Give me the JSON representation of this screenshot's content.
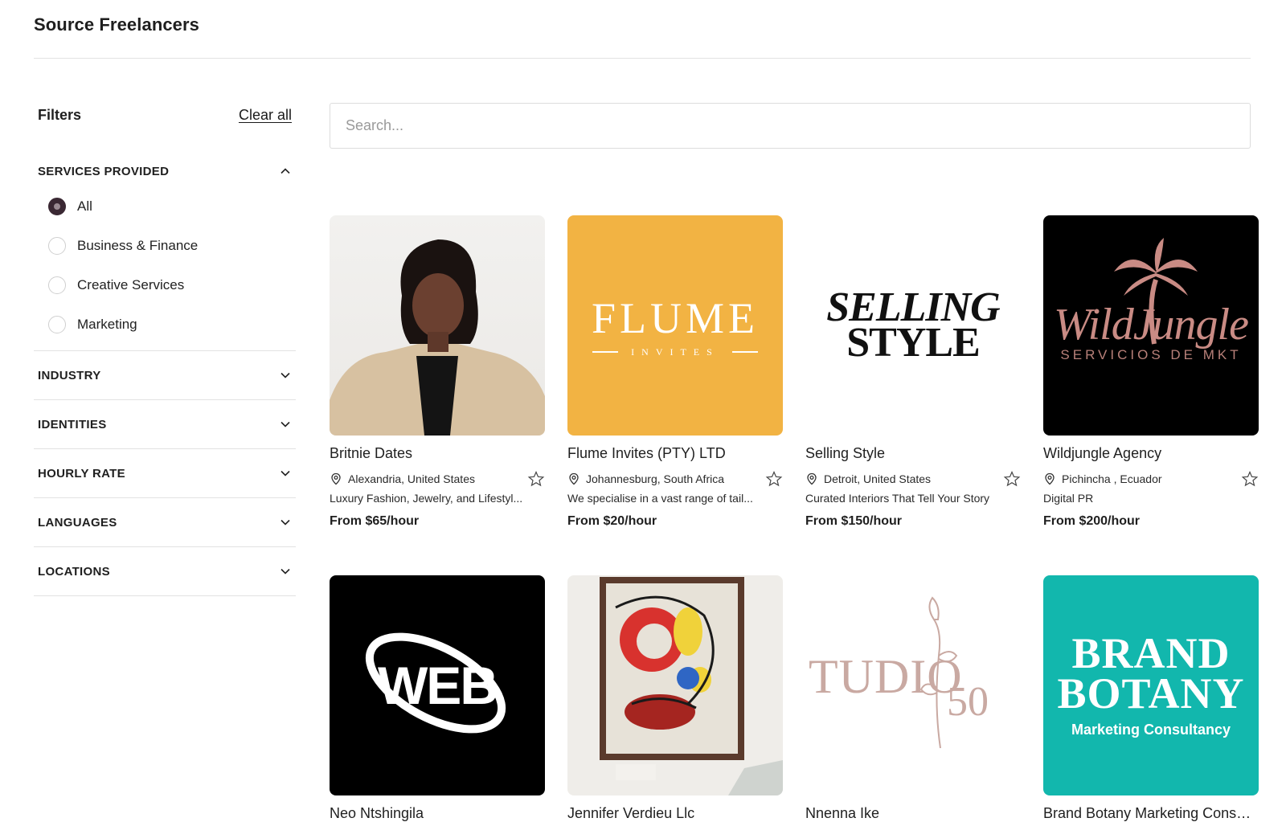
{
  "page": {
    "title": "Source Freelancers"
  },
  "filters": {
    "title": "Filters",
    "clear_all": "Clear all",
    "services": {
      "title": "SERVICES PROVIDED",
      "options": [
        {
          "label": "All",
          "checked": true
        },
        {
          "label": "Business & Finance",
          "checked": false
        },
        {
          "label": "Creative Services",
          "checked": false
        },
        {
          "label": "Marketing",
          "checked": false
        }
      ]
    },
    "sections": [
      "INDUSTRY",
      "IDENTITIES",
      "HOURLY RATE",
      "LANGUAGES",
      "LOCATIONS"
    ]
  },
  "search": {
    "placeholder": "Search...",
    "value": ""
  },
  "cards": [
    {
      "name": "Britnie Dates",
      "location": "Alexandria, United States",
      "description": "Luxury Fashion, Jewelry, and Lifestyl...",
      "rate": "From $65/hour"
    },
    {
      "name": "Flume Invites (PTY) LTD",
      "location": "Johannesburg, South Africa",
      "description": "We specialise in a vast range of tail...",
      "rate": "From $20/hour",
      "logo": {
        "line1": "FLUME",
        "line2": "INVITES"
      }
    },
    {
      "name": "Selling Style",
      "location": "Detroit, United States",
      "description": "Curated Interiors That Tell Your Story",
      "rate": "From $150/hour",
      "logo": {
        "line1": "SELLING",
        "line2": "STYLE"
      }
    },
    {
      "name": "Wildjungle Agency",
      "location": "Pichincha , Ecuador",
      "description": "Digital PR",
      "rate": "From $200/hour",
      "logo": {
        "line1": "WildJungle",
        "line2": "SERVICIOS DE MKT"
      }
    },
    {
      "name": "Neo Ntshingila",
      "logo": {
        "line1": "WEB"
      }
    },
    {
      "name": "Jennifer Verdieu Llc"
    },
    {
      "name": "Nnenna Ike",
      "logo": {
        "line1": "TUDIO",
        "line2": "50"
      }
    },
    {
      "name": "Brand Botany Marketing Consul...",
      "logo": {
        "line1": "BRAND",
        "line2": "BOTANY",
        "line3": "Marketing Consultancy"
      }
    }
  ],
  "colors": {
    "accent": "#3a2833",
    "flume_bg": "#f2b343",
    "brand_bg": "#12b7ad"
  }
}
